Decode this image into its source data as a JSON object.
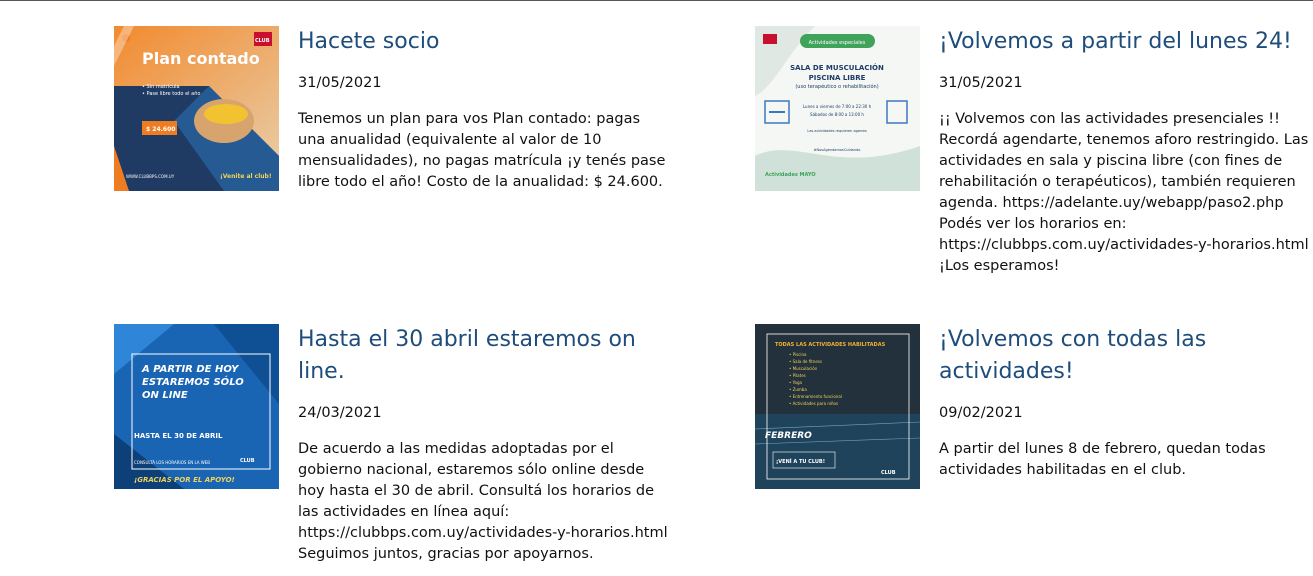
{
  "posts": [
    {
      "title": "Hacete socio",
      "date": "31/05/2021",
      "body": "Tenemos un plan para vos Plan contado: pagas una anualidad (equivalente al valor de 10 mensualidades), no pagas matrícula ¡y tenés pase libre todo el año! Costo de la anualidad: $ 24.600.",
      "image": {
        "heading": "Plan contado",
        "bullets": [
          "• Sin matrícula",
          "• Pase libre todo el año"
        ],
        "price": "$ 24.600",
        "logo": "CLUB",
        "site": "WWW.CLUBBPS.COM.UY",
        "cta": "¡Venite al club!"
      }
    },
    {
      "title": "¡Volvemos a partir del lunes 24!",
      "date": "31/05/2021",
      "body": "¡¡ Volvemos con las actividades presenciales !! Recordá agendarte, tenemos aforo restringido. Las actividades en sala y piscina libre (con fines de rehabilitación o terapéuticos), también requieren agenda. https://adelante.uy/webapp/paso2.php Podés ver los horarios en: https://clubbps.com.uy/actividades-y-horarios.html ¡Los esperamos!",
      "image": {
        "badge": "Actividades especiales",
        "line1": "SALA DE MUSCULACIÓN",
        "line2": "PISCINA LIBRE",
        "line3": "(uso terapéutico o rehabilitación)",
        "hours1": "Lunes a viernes de 7:00 a 22:30 h",
        "hours2": "Sábados de 8:00 a 13:00 h",
        "note": "Las actividades requieren agenda",
        "hashtag": "#NosAgendamosCuidando",
        "footer": "Actividades MAYO"
      }
    },
    {
      "title": "Hasta el 30 abril estaremos on line.",
      "date": "24/03/2021",
      "body": "De acuerdo a las medidas adoptadas por el gobierno nacional, estaremos sólo online desde hoy hasta el 30 de abril. Consultá los horarios de las actividades en línea aquí: https://clubbps.com.uy/actividades-y-horarios.html Seguimos juntos, gracias por apoyarnos.",
      "image": {
        "line1": "A PARTIR DE HOY",
        "line2": "ESTAREMOS SÓLO",
        "line3": "ON LINE",
        "line4": "HASTA EL 30 DE ABRIL",
        "small": "CONSULTÁ LOS HORARIOS EN LA WEB",
        "footer": "¡GRACIAS POR EL APOYO!",
        "logo": "CLUB"
      }
    },
    {
      "title": "¡Volvemos con todas las actividades!",
      "date": "09/02/2021",
      "body": "A partir del lunes 8 de febrero, quedan todas actividades habilitadas en el club.",
      "image": {
        "header": "TODAS LAS ACTIVIDADES HABILITADAS",
        "list": [
          "• Piscina",
          "• Sala de fitness",
          "• Musculación",
          "• Pilates",
          "• Yoga",
          "• Zumba",
          "• Entrenamiento funcional",
          "• Actividades para niños"
        ],
        "month": "FEBRERO",
        "cta": "¡VENÍ A TU CLUB!",
        "logo": "CLUB"
      }
    }
  ],
  "colors": {
    "title": "#1e4d7b",
    "text": "#111111",
    "thumb1_bg": "#1f3b64",
    "thumb1_accent": "#f07c22",
    "thumb2_bg": "#e8efe8",
    "thumb3_bg": "#1a64b4",
    "thumb4_bg": "#1f2a33"
  }
}
